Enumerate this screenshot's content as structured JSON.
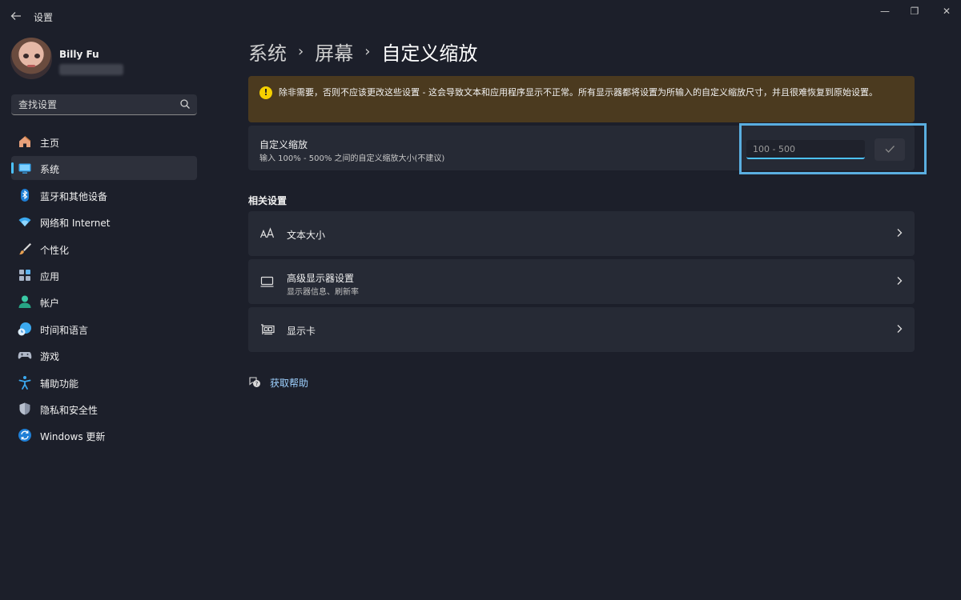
{
  "window": {
    "app_title": "设置",
    "controls": {
      "minimize": "—",
      "maximize": "❐",
      "close": "✕"
    }
  },
  "profile": {
    "name": "Billy Fu"
  },
  "search": {
    "placeholder": "查找设置"
  },
  "sidebar": {
    "items": [
      {
        "label": "主页",
        "icon": "home-icon"
      },
      {
        "label": "系统",
        "icon": "system-icon",
        "active": true
      },
      {
        "label": "蓝牙和其他设备",
        "icon": "bluetooth-icon"
      },
      {
        "label": "网络和 Internet",
        "icon": "network-icon"
      },
      {
        "label": "个性化",
        "icon": "personalization-brush-icon"
      },
      {
        "label": "应用",
        "icon": "apps-icon"
      },
      {
        "label": "帐户",
        "icon": "account-icon"
      },
      {
        "label": "时间和语言",
        "icon": "time-language-icon"
      },
      {
        "label": "游戏",
        "icon": "gaming-icon"
      },
      {
        "label": "辅助功能",
        "icon": "accessibility-icon"
      },
      {
        "label": "隐私和安全性",
        "icon": "privacy-shield-icon"
      },
      {
        "label": "Windows 更新",
        "icon": "windows-update-icon"
      }
    ]
  },
  "breadcrumb": {
    "parts": [
      "系统",
      "屏幕"
    ],
    "separator": "›",
    "current": "自定义缩放"
  },
  "warning": {
    "icon_glyph": "!",
    "text": "除非需要，否则不应该更改这些设置 - 这会导致文本和应用程序显示不正常。所有显示器都将设置为所输入的自定义缩放尺寸，并且很难恢复到原始设置。"
  },
  "custom_scale": {
    "title": "自定义缩放",
    "description": "输入 100% - 500% 之间的自定义缩放大小(不建议)",
    "input_placeholder": "100 - 500",
    "input_value": ""
  },
  "related": {
    "title": "相关设置",
    "items": [
      {
        "title": "文本大小",
        "subtitle": "",
        "icon": "text-size-icon"
      },
      {
        "title": "高级显示器设置",
        "subtitle": "显示器信息、刷新率",
        "icon": "monitor-icon"
      },
      {
        "title": "显示卡",
        "subtitle": "",
        "icon": "graphics-card-icon"
      }
    ]
  },
  "help": {
    "label": "获取帮助"
  },
  "colors": {
    "accent": "#4cc2ff",
    "background": "#1c1f2a",
    "card": "#262a35",
    "warning_bg": "#4b3a1f",
    "warning_icon": "#f5d000",
    "highlight": "#5aaee0"
  }
}
